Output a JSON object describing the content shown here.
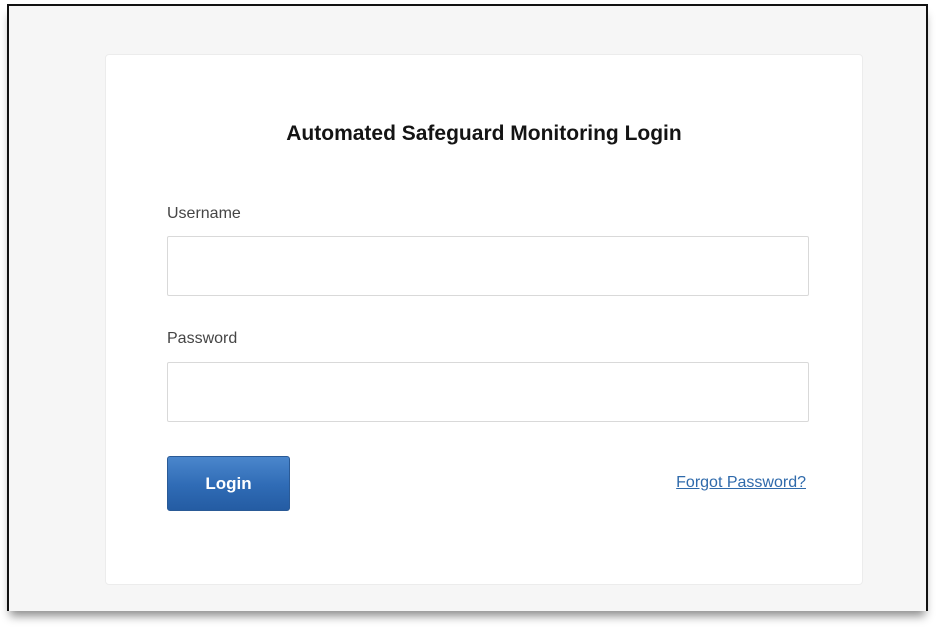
{
  "login": {
    "title": "Automated Safeguard Monitoring Login",
    "username_label": "Username",
    "username_value": "",
    "password_label": "Password",
    "password_value": "",
    "login_button": "Login",
    "forgot_password_link": "Forgot Password?"
  },
  "colors": {
    "page_background": "#f6f6f6",
    "panel_background": "#ffffff",
    "button_blue": "#2f6bb5",
    "link_blue": "#2f6aab"
  }
}
